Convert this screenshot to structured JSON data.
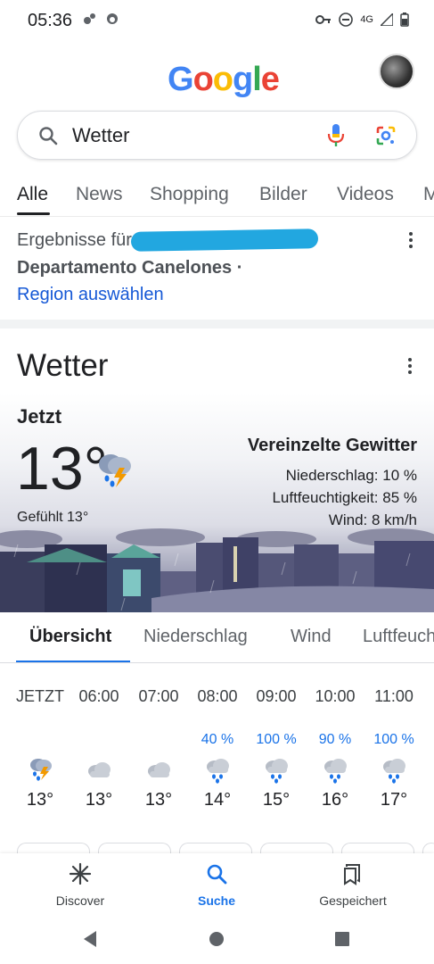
{
  "status_bar": {
    "time": "05:36",
    "network": "4G"
  },
  "header": {
    "logo_letters": [
      "G",
      "o",
      "o",
      "g",
      "l",
      "e"
    ],
    "logo_colors": [
      "#4285F4",
      "#EA4335",
      "#FBBC05",
      "#4285F4",
      "#34A853",
      "#EA4335"
    ]
  },
  "search": {
    "query": "Wetter"
  },
  "tabs": [
    {
      "label": "Alle",
      "active": true
    },
    {
      "label": "News"
    },
    {
      "label": "Shopping"
    },
    {
      "label": "Bilder"
    },
    {
      "label": "Videos"
    },
    {
      "label": "M"
    }
  ],
  "location": {
    "results_for": "Ergebnisse für",
    "place": "Departamento Canelones ·",
    "select_region": "Region auswählen"
  },
  "weather": {
    "title": "Wetter",
    "now_label": "Jetzt",
    "temperature": "13°",
    "feels_like": "Gefühlt 13°",
    "condition": "Vereinzelte Gewitter",
    "precipitation": "Niederschlag: 10 %",
    "humidity": "Luftfeuchtigkeit: 85 %",
    "wind": "Wind: 8 km/h",
    "tabs": [
      "Übersicht",
      "Niederschlag",
      "Wind",
      "Luftfeuchtigkeit"
    ],
    "hourly": [
      {
        "time": "JETZT",
        "precip": "",
        "icon": "thunderstorm-icon",
        "temp": "13°"
      },
      {
        "time": "06:00",
        "precip": "",
        "icon": "cloud-icon",
        "temp": "13°"
      },
      {
        "time": "07:00",
        "precip": "",
        "icon": "cloud-icon",
        "temp": "13°"
      },
      {
        "time": "08:00",
        "precip": "40 %",
        "icon": "rain-icon",
        "temp": "14°"
      },
      {
        "time": "09:00",
        "precip": "100 %",
        "icon": "rain-icon",
        "temp": "15°"
      },
      {
        "time": "10:00",
        "precip": "90 %",
        "icon": "rain-icon",
        "temp": "16°"
      },
      {
        "time": "11:00",
        "precip": "100 %",
        "icon": "rain-icon",
        "temp": "17°"
      }
    ]
  },
  "bottom_nav": [
    {
      "label": "Discover",
      "icon": "asterisk-icon"
    },
    {
      "label": "Suche",
      "icon": "search-icon",
      "active": true
    },
    {
      "label": "Gespeichert",
      "icon": "bookmarks-icon"
    }
  ],
  "colors": {
    "accent": "#1a73e8",
    "link": "#1558d6",
    "redaction": "#22a7e0"
  }
}
